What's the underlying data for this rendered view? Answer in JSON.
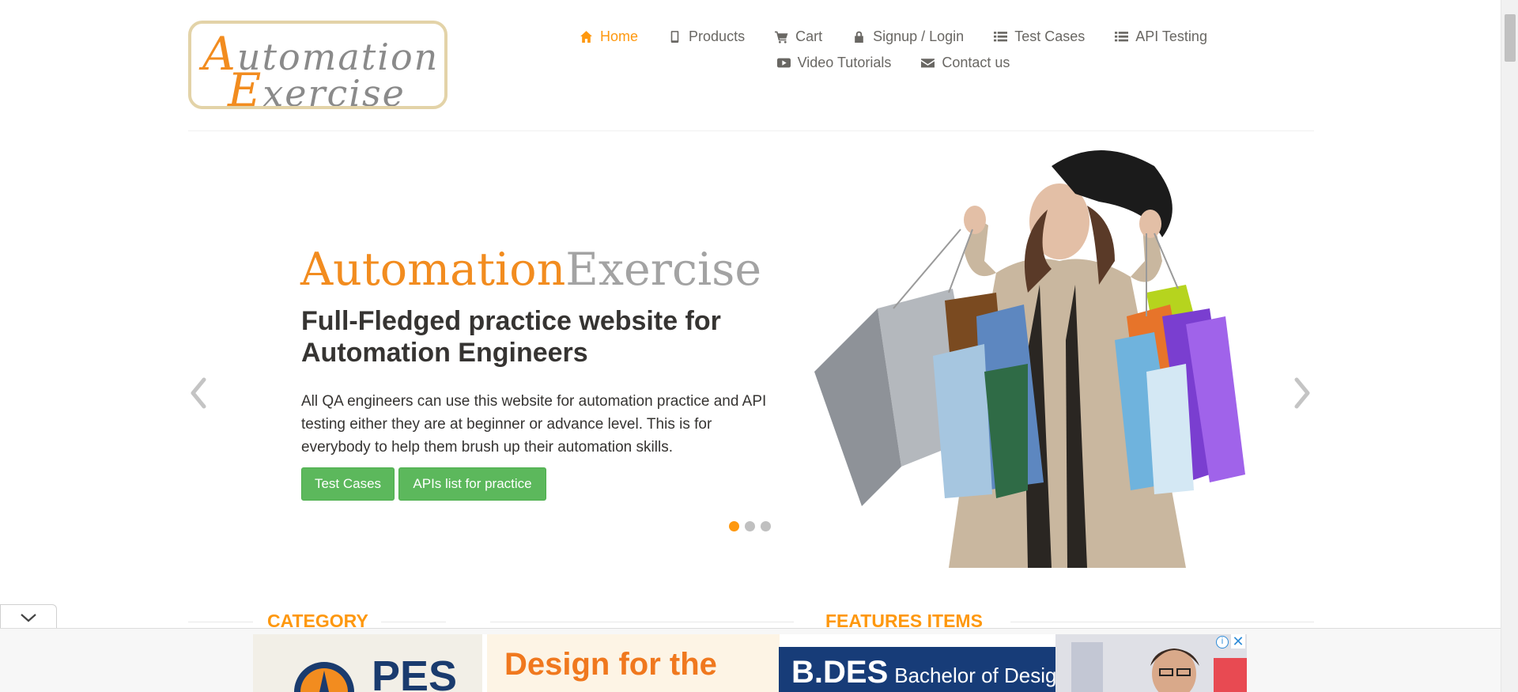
{
  "logo": {
    "line1_first": "A",
    "line1_rest": "utomation",
    "line2_first": "E",
    "line2_rest": "xercise"
  },
  "nav": {
    "items": [
      {
        "label": "Home",
        "icon": "home-icon"
      },
      {
        "label": "Products",
        "icon": "mobile-icon"
      },
      {
        "label": "Cart",
        "icon": "cart-icon"
      },
      {
        "label": "Signup / Login",
        "icon": "lock-icon"
      },
      {
        "label": "Test Cases",
        "icon": "list-icon"
      },
      {
        "label": "API Testing",
        "icon": "list-icon"
      },
      {
        "label": "Video Tutorials",
        "icon": "youtube-icon"
      },
      {
        "label": "Contact us",
        "icon": "envelope-icon"
      }
    ],
    "active_index": 0
  },
  "hero": {
    "brand_a": "Automation",
    "brand_b": "Exercise",
    "title": "Full-Fledged practice website for Automation Engineers",
    "text": "All QA engineers can use this website for automation practice and API testing either they are at beginner or advance level. This is for everybody to help them brush up their automation skills.",
    "button_test_cases": "Test Cases",
    "button_apis": "APIs list for practice",
    "slide_count": 3,
    "active_slide": 0
  },
  "sections": {
    "category": "CATEGORY",
    "features": "FEATURES ITEMS"
  },
  "ad": {
    "logo_text": "PES",
    "design_text": "Design for the",
    "bdes_title": "B.DES",
    "bdes_subtitle": "Bachelor of Design",
    "info_label": "i",
    "close_label": "✕"
  },
  "colors": {
    "accent": "#fe980f",
    "button": "#5cb85c",
    "text": "#363432",
    "nav_text": "#696763"
  }
}
